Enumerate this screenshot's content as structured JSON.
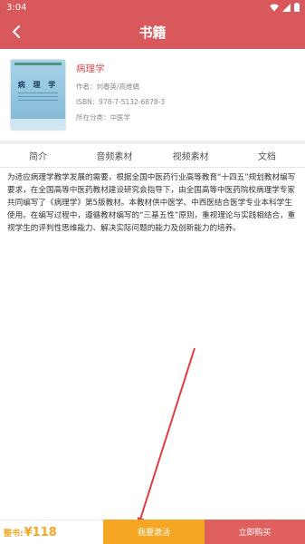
{
  "status_bar": {
    "time": "3:04"
  },
  "app_bar": {
    "title": "书籍"
  },
  "book": {
    "title": "病理学",
    "author": "作者：刘春英/高维娟",
    "isbn": "ISBN：978-7-5132-6878-3",
    "category": "所在分类：中医学",
    "cover_title": "病 理 学"
  },
  "tabs": [
    {
      "label": "简介"
    },
    {
      "label": "音频素材"
    },
    {
      "label": "视频素材"
    },
    {
      "label": "文档"
    }
  ],
  "description": "为适应病理学教学发展的需要，根据全国中医药行业高等教育“十四五”规划教材编写要求，在全国高等中医药教材建设研究会指导下，由全国高等中医药院校病理学专家共同编写了《病理学》第5版教材。本教材供中医学、中西医结合医学专业本科学生使用。在编写过程中，遵循教材编写的“三基五性”原则，重视理论与实践相结合，重视学生的评判性思维能力、解决实际问题的能力及创新能力的培养。",
  "bottom_bar": {
    "price_label": "整书:",
    "price_value": "¥118",
    "activate_label": "我要激活",
    "buy_label": "立即购买"
  },
  "colors": {
    "header": "#d9585c",
    "title_accent": "#d94f53",
    "activate": "#f5a623",
    "buy": "#e0605e",
    "annotation_arrow": "#e23b3b"
  }
}
